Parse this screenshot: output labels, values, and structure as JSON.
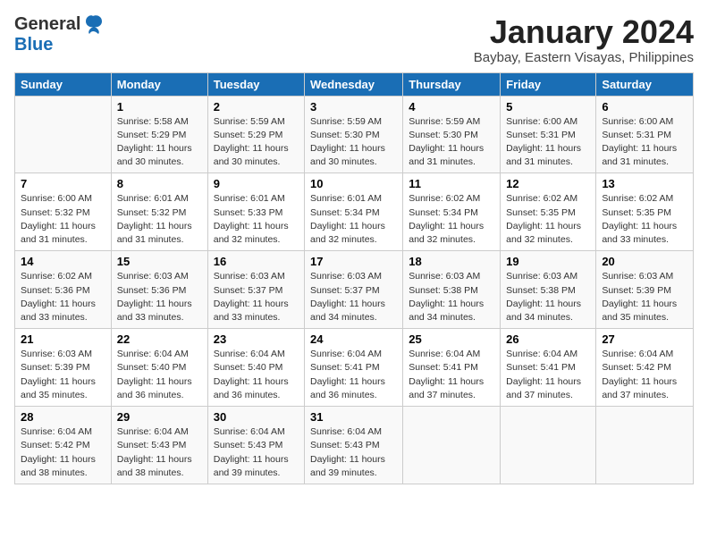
{
  "header": {
    "logo_general": "General",
    "logo_blue": "Blue",
    "month_title": "January 2024",
    "location": "Baybay, Eastern Visayas, Philippines"
  },
  "weekdays": [
    "Sunday",
    "Monday",
    "Tuesday",
    "Wednesday",
    "Thursday",
    "Friday",
    "Saturday"
  ],
  "weeks": [
    [
      {
        "day": "",
        "detail": ""
      },
      {
        "day": "1",
        "detail": "Sunrise: 5:58 AM\nSunset: 5:29 PM\nDaylight: 11 hours\nand 30 minutes."
      },
      {
        "day": "2",
        "detail": "Sunrise: 5:59 AM\nSunset: 5:29 PM\nDaylight: 11 hours\nand 30 minutes."
      },
      {
        "day": "3",
        "detail": "Sunrise: 5:59 AM\nSunset: 5:30 PM\nDaylight: 11 hours\nand 30 minutes."
      },
      {
        "day": "4",
        "detail": "Sunrise: 5:59 AM\nSunset: 5:30 PM\nDaylight: 11 hours\nand 31 minutes."
      },
      {
        "day": "5",
        "detail": "Sunrise: 6:00 AM\nSunset: 5:31 PM\nDaylight: 11 hours\nand 31 minutes."
      },
      {
        "day": "6",
        "detail": "Sunrise: 6:00 AM\nSunset: 5:31 PM\nDaylight: 11 hours\nand 31 minutes."
      }
    ],
    [
      {
        "day": "7",
        "detail": "Sunrise: 6:00 AM\nSunset: 5:32 PM\nDaylight: 11 hours\nand 31 minutes."
      },
      {
        "day": "8",
        "detail": "Sunrise: 6:01 AM\nSunset: 5:32 PM\nDaylight: 11 hours\nand 31 minutes."
      },
      {
        "day": "9",
        "detail": "Sunrise: 6:01 AM\nSunset: 5:33 PM\nDaylight: 11 hours\nand 32 minutes."
      },
      {
        "day": "10",
        "detail": "Sunrise: 6:01 AM\nSunset: 5:34 PM\nDaylight: 11 hours\nand 32 minutes."
      },
      {
        "day": "11",
        "detail": "Sunrise: 6:02 AM\nSunset: 5:34 PM\nDaylight: 11 hours\nand 32 minutes."
      },
      {
        "day": "12",
        "detail": "Sunrise: 6:02 AM\nSunset: 5:35 PM\nDaylight: 11 hours\nand 32 minutes."
      },
      {
        "day": "13",
        "detail": "Sunrise: 6:02 AM\nSunset: 5:35 PM\nDaylight: 11 hours\nand 33 minutes."
      }
    ],
    [
      {
        "day": "14",
        "detail": "Sunrise: 6:02 AM\nSunset: 5:36 PM\nDaylight: 11 hours\nand 33 minutes."
      },
      {
        "day": "15",
        "detail": "Sunrise: 6:03 AM\nSunset: 5:36 PM\nDaylight: 11 hours\nand 33 minutes."
      },
      {
        "day": "16",
        "detail": "Sunrise: 6:03 AM\nSunset: 5:37 PM\nDaylight: 11 hours\nand 33 minutes."
      },
      {
        "day": "17",
        "detail": "Sunrise: 6:03 AM\nSunset: 5:37 PM\nDaylight: 11 hours\nand 34 minutes."
      },
      {
        "day": "18",
        "detail": "Sunrise: 6:03 AM\nSunset: 5:38 PM\nDaylight: 11 hours\nand 34 minutes."
      },
      {
        "day": "19",
        "detail": "Sunrise: 6:03 AM\nSunset: 5:38 PM\nDaylight: 11 hours\nand 34 minutes."
      },
      {
        "day": "20",
        "detail": "Sunrise: 6:03 AM\nSunset: 5:39 PM\nDaylight: 11 hours\nand 35 minutes."
      }
    ],
    [
      {
        "day": "21",
        "detail": "Sunrise: 6:03 AM\nSunset: 5:39 PM\nDaylight: 11 hours\nand 35 minutes."
      },
      {
        "day": "22",
        "detail": "Sunrise: 6:04 AM\nSunset: 5:40 PM\nDaylight: 11 hours\nand 36 minutes."
      },
      {
        "day": "23",
        "detail": "Sunrise: 6:04 AM\nSunset: 5:40 PM\nDaylight: 11 hours\nand 36 minutes."
      },
      {
        "day": "24",
        "detail": "Sunrise: 6:04 AM\nSunset: 5:41 PM\nDaylight: 11 hours\nand 36 minutes."
      },
      {
        "day": "25",
        "detail": "Sunrise: 6:04 AM\nSunset: 5:41 PM\nDaylight: 11 hours\nand 37 minutes."
      },
      {
        "day": "26",
        "detail": "Sunrise: 6:04 AM\nSunset: 5:41 PM\nDaylight: 11 hours\nand 37 minutes."
      },
      {
        "day": "27",
        "detail": "Sunrise: 6:04 AM\nSunset: 5:42 PM\nDaylight: 11 hours\nand 37 minutes."
      }
    ],
    [
      {
        "day": "28",
        "detail": "Sunrise: 6:04 AM\nSunset: 5:42 PM\nDaylight: 11 hours\nand 38 minutes."
      },
      {
        "day": "29",
        "detail": "Sunrise: 6:04 AM\nSunset: 5:43 PM\nDaylight: 11 hours\nand 38 minutes."
      },
      {
        "day": "30",
        "detail": "Sunrise: 6:04 AM\nSunset: 5:43 PM\nDaylight: 11 hours\nand 39 minutes."
      },
      {
        "day": "31",
        "detail": "Sunrise: 6:04 AM\nSunset: 5:43 PM\nDaylight: 11 hours\nand 39 minutes."
      },
      {
        "day": "",
        "detail": ""
      },
      {
        "day": "",
        "detail": ""
      },
      {
        "day": "",
        "detail": ""
      }
    ]
  ]
}
